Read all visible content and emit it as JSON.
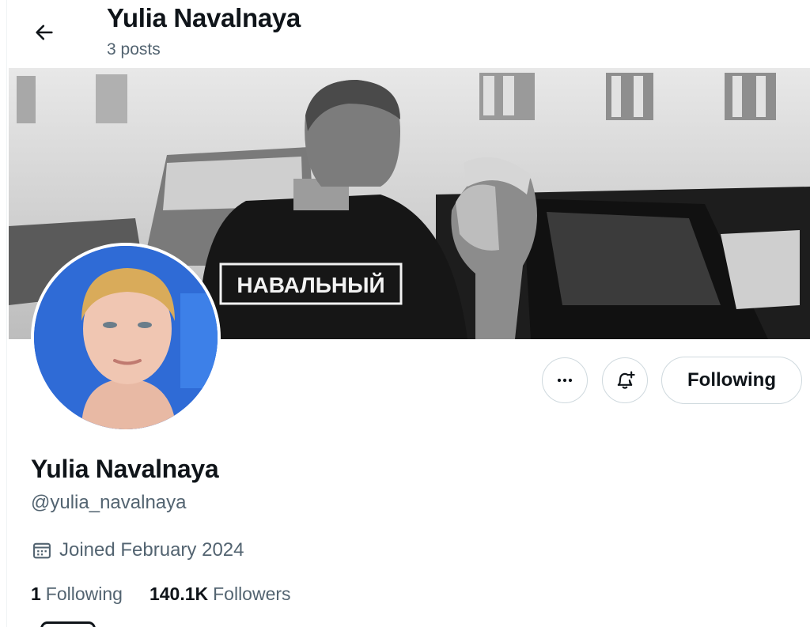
{
  "header": {
    "display_name": "Yulia Navalnaya",
    "post_count": "3 posts"
  },
  "banner": {
    "shirt_text": "НАВАЛЬНЫЙ"
  },
  "profile": {
    "display_name": "Yulia Navalnaya",
    "handle": "@yulia_navalnaya",
    "joined": "Joined February 2024",
    "following_count": "1",
    "following_label": "Following",
    "followers_count": "140.1K",
    "followers_label": "Followers"
  },
  "actions": {
    "following_button": "Following"
  },
  "icons": {
    "back": "arrow-left-icon",
    "more": "more-horizontal-icon",
    "bell": "notification-bell-plus-icon",
    "calendar": "calendar-icon"
  },
  "colors": {
    "text": "#0f1419",
    "secondary": "#536471",
    "border": "#cfd9de",
    "avatar_bg": "#2f6bd6"
  }
}
